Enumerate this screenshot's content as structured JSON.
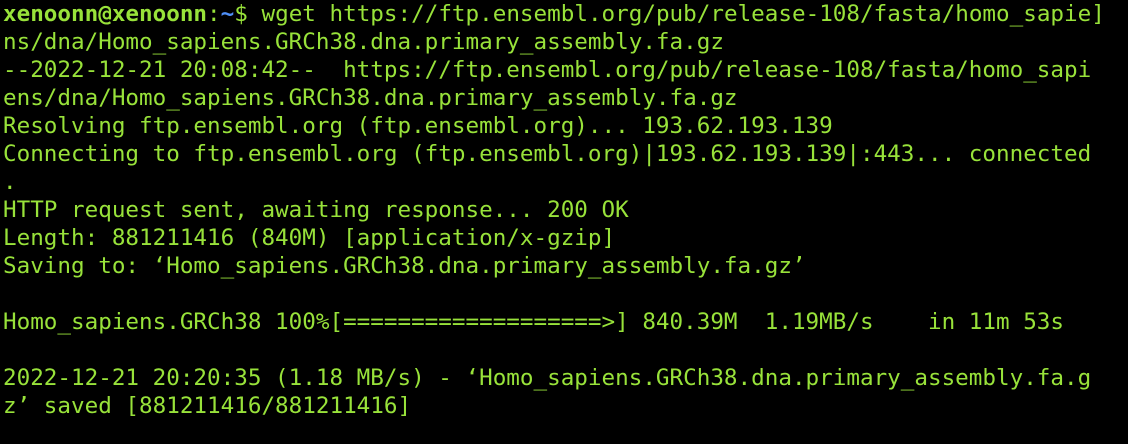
{
  "colors": {
    "background": "#000000",
    "text": "#98e23a",
    "path": "#4f8ff7"
  },
  "prompt": {
    "user_host": "xenoonn@xenoonn",
    "separator": ":",
    "path": "~",
    "dollar": "$ "
  },
  "command": {
    "text_line1": "wget https://ftp.ensembl.org/pub/release-108/fasta/homo_sapie",
    "wrap_marker": "]",
    "text_line2": "ns/dna/Homo_sapiens.GRCh38.dna.primary_assembly.fa.gz"
  },
  "output": {
    "lines": [
      "--2022-12-21 20:08:42--  https://ftp.ensembl.org/pub/release-108/fasta/homo_sapi",
      "ens/dna/Homo_sapiens.GRCh38.dna.primary_assembly.fa.gz",
      "Resolving ftp.ensembl.org (ftp.ensembl.org)... 193.62.193.139",
      "Connecting to ftp.ensembl.org (ftp.ensembl.org)|193.62.193.139|:443... connected",
      ".",
      "HTTP request sent, awaiting response... 200 OK",
      "Length: 881211416 (840M) [application/x-gzip]",
      "Saving to: ‘Homo_sapiens.GRCh38.dna.primary_assembly.fa.gz’"
    ],
    "progress_line": "Homo_sapiens.GRCh38 100%[===================>] 840.39M  1.19MB/s    in 11m 53s",
    "progress_percent": 100,
    "saved_lines": [
      "2022-12-21 20:20:35 (1.18 MB/s) - ‘Homo_sapiens.GRCh38.dna.primary_assembly.fa.g",
      "z’ saved [881211416/881211416]"
    ]
  }
}
